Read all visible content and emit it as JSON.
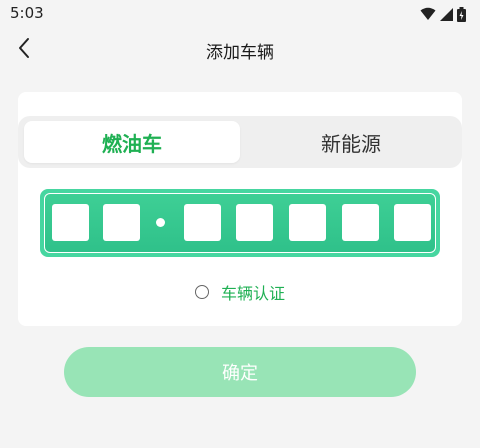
{
  "status_bar": {
    "time": "5:03",
    "icons": [
      "wifi-icon",
      "signal-icon",
      "battery-icon"
    ]
  },
  "header": {
    "title": "添加车辆",
    "back_icon": "chevron-left-icon"
  },
  "tabs": [
    {
      "label": "燃油车",
      "selected": true
    },
    {
      "label": "新能源",
      "selected": false
    }
  ],
  "plate": {
    "slots_before_dot": 2,
    "slots_after_dot": 5,
    "values": [
      "",
      "",
      "",
      "",
      "",
      "",
      ""
    ]
  },
  "certification": {
    "label": "车辆认证",
    "checked": false
  },
  "confirm_button": {
    "label": "确定"
  },
  "colors": {
    "accent_green": "#1fb053",
    "plate_green": "#46d6a0",
    "button_disabled_green": "#98e4b6"
  }
}
